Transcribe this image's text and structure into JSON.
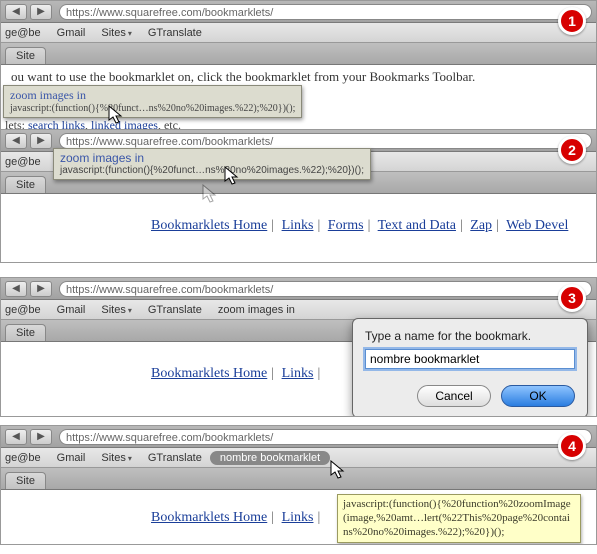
{
  "url": "https://www.squarefree.com/bookmarklets/",
  "bookmarks_bar": {
    "left_cut": "ge@be",
    "items": [
      "Gmail",
      "Sites",
      "GTranslate"
    ]
  },
  "tab_label": "Site",
  "step1": {
    "body_text": "ou want to use the bookmarklet on, click the bookmarklet from your Bookmarks Toolbar.",
    "tooltip_title": "zoom images in",
    "tooltip_sub": "javascript:(function(){%20funct…ns%20no%20images.%22);%20})();",
    "cat_prefix": "lets:",
    "cat_links": [
      "search links",
      "linked images"
    ],
    "cat_suffix": ", etc."
  },
  "step2": {
    "tooltip_title": "zoom images in",
    "tooltip_sub": "javascript:(function(){%20funct…ns%20no%20images.%22);%20})();",
    "links": [
      "Bookmarklets Home",
      "Links",
      "Forms",
      "Text and Data",
      "Zap",
      "Web Devel"
    ]
  },
  "step3": {
    "extra_bm": "zoom images in",
    "links": [
      "Bookmarklets Home",
      "Links"
    ],
    "dialog_label": "Type a name for the bookmark.",
    "dialog_value": "nombre bookmarklet",
    "cancel": "Cancel",
    "ok": "OK"
  },
  "step4": {
    "new_bm": "nombre bookmarklet",
    "links": [
      "Bookmarklets Home",
      "Links"
    ],
    "yellow_tip": "javascript:(function(){%20function%20zoomImage(image,%20amt…lert(%22This%20page%20contains%20no%20images.%22);%20})();"
  },
  "badges": [
    "1",
    "2",
    "3",
    "4"
  ]
}
